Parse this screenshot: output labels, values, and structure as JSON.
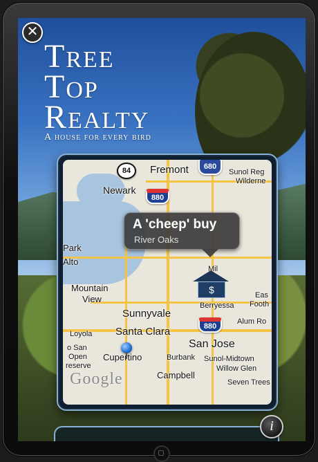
{
  "app": {
    "title_lines": [
      "Tree",
      "Top",
      "Realty"
    ],
    "tagline": "A house for every bird"
  },
  "controls": {
    "close_icon": "✕",
    "info_icon": "i"
  },
  "map": {
    "callout_title": "A 'cheep' buy",
    "callout_subtitle": "River Oaks",
    "marker_symbol": "$",
    "watermark": "Google",
    "labels": {
      "fremont": "Fremont",
      "newark": "Newark",
      "sunol_reg": "Sunol Reg",
      "wilderne": "Wilderne",
      "park": "Park",
      "alto": "Alto",
      "mountain_view_1": "Mountain",
      "mountain_view_2": "View",
      "sunnyvale": "Sunnyvale",
      "santa_clara": "Santa Clara",
      "san_jose": "San Jose",
      "loyola": "Loyola",
      "san_open_1": "o San",
      "san_open_2": "Open",
      "san_open_3": "reserve",
      "cupertino": "Cupertino",
      "burbank": "Burbank",
      "sunol_midtown": "Sunol-Midtown",
      "willow_glen": "Willow Glen",
      "campbell": "Campbell",
      "seven_trees": "Seven Trees",
      "berryessa": "Berryessa",
      "alum_ro": "Alum Ro",
      "east_foothills_1": "Eas",
      "east_foothills_2": "Footh",
      "milpitas": "Mil"
    },
    "shields": {
      "r84": "84",
      "r880_top": "880",
      "r680": "680",
      "r880_mid": "880"
    }
  }
}
